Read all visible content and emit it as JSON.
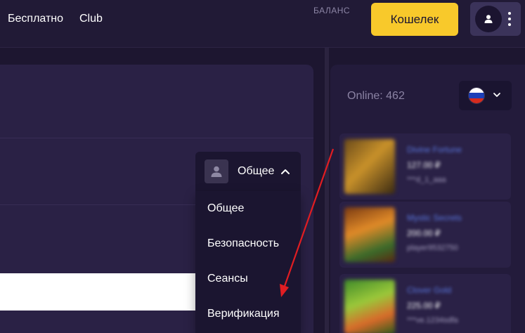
{
  "header": {
    "nav": [
      {
        "label": "Бесплатно"
      },
      {
        "label": "Club"
      }
    ],
    "balance_label": "БАЛАНС",
    "wallet_label": "Кошелек",
    "avatar_icon": "user-icon",
    "more_icon": "vertical-dots-icon"
  },
  "profile_dropdown": {
    "current": "Общее",
    "chevron_icon": "chevron-up-icon",
    "avatar_icon": "user-icon",
    "items": [
      {
        "label": "Общее"
      },
      {
        "label": "Безопасность"
      },
      {
        "label": "Сеансы"
      },
      {
        "label": "Верификация"
      }
    ]
  },
  "sidebar": {
    "online": "Online: 462",
    "language_flag": "russia-flag-icon",
    "language_chevron": "chevron-down-icon",
    "games": [
      {
        "title": "Divine Fortune",
        "amount": "127.00 ₽",
        "user": "***d_1_aaa"
      },
      {
        "title": "Mystic Secrets",
        "amount": "200.00 ₽",
        "user": "player9532750"
      },
      {
        "title": "Clover Gold",
        "amount": "225.00 ₽",
        "user": "***ve.1234sdfa"
      }
    ]
  },
  "colors": {
    "accent": "#f8c92b",
    "background": "#1d1630",
    "panel": "#2a2145",
    "annotation_arrow": "#e11d22"
  }
}
